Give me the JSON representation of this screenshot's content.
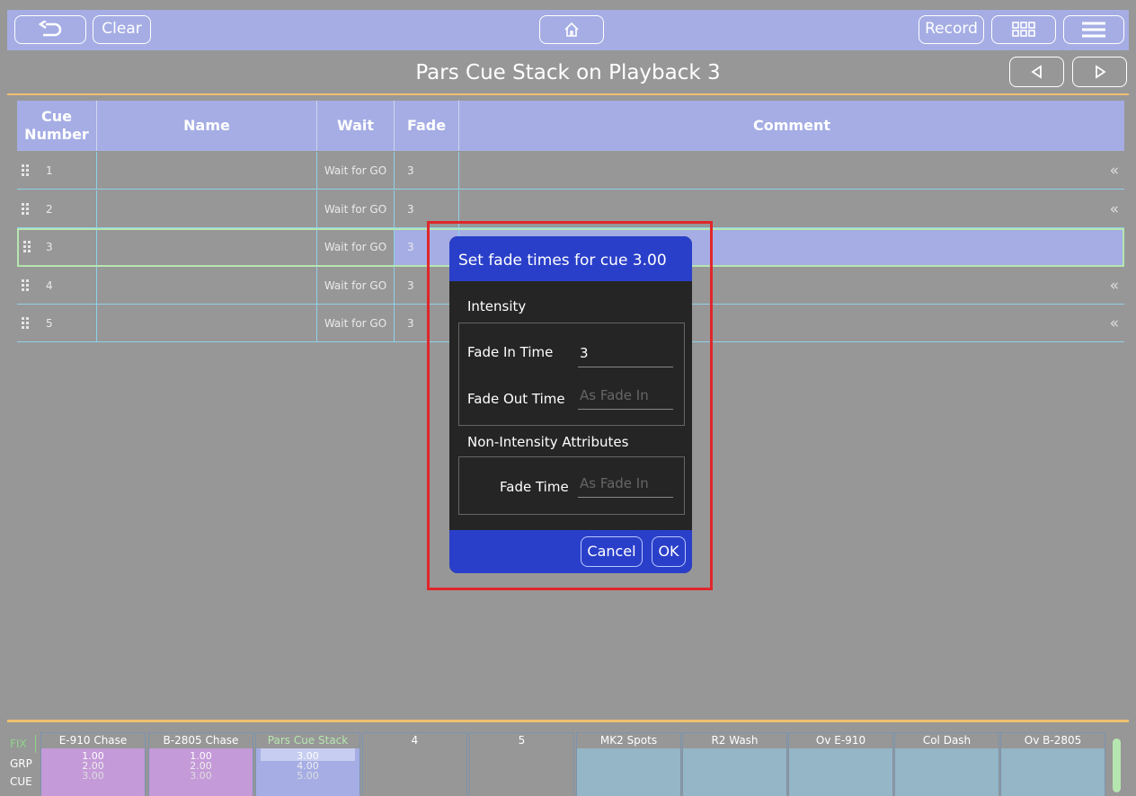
{
  "topbar": {
    "clear_label": "Clear",
    "record_label": "Record",
    "back_icon": "undo-arrow-icon",
    "home_icon": "home-icon",
    "grid_icon": "grid-icon",
    "menu_icon": "hamburger-menu-icon"
  },
  "page": {
    "title": "Pars Cue Stack on Playback 3",
    "prev_icon": "triangle-left-icon",
    "next_icon": "triangle-right-icon"
  },
  "table": {
    "headers": {
      "cue_number": "Cue Number",
      "name": "Name",
      "wait": "Wait",
      "fade": "Fade",
      "comment": "Comment"
    },
    "rows": [
      {
        "number": "1",
        "name": "",
        "wait": "Wait for GO",
        "fade": "3",
        "comment": ""
      },
      {
        "number": "2",
        "name": "",
        "wait": "Wait for GO",
        "fade": "3",
        "comment": ""
      },
      {
        "number": "3",
        "name": "",
        "wait": "Wait for GO",
        "fade": "3",
        "comment": ""
      },
      {
        "number": "4",
        "name": "",
        "wait": "Wait for GO",
        "fade": "3",
        "comment": ""
      },
      {
        "number": "5",
        "name": "",
        "wait": "Wait for GO",
        "fade": "3",
        "comment": ""
      }
    ],
    "selected_row": 3
  },
  "dialog": {
    "title": "Set fade times for cue 3.00",
    "intensity_label": "Intensity",
    "fade_in_label": "Fade In Time",
    "fade_in_value": "3",
    "fade_out_label": "Fade Out Time",
    "fade_out_placeholder": "As Fade In",
    "non_intensity_label": "Non-Intensity Attributes",
    "fade_time_label": "Fade Time",
    "fade_time_placeholder": "As Fade In",
    "cancel_label": "Cancel",
    "ok_label": "OK"
  },
  "playback_bar": {
    "side_labels": [
      "FIX",
      "GRP",
      "CUE"
    ],
    "playbacks": [
      {
        "name": "E-910 Chase",
        "values": [
          "1.00",
          "2.00",
          "3.00"
        ],
        "color": "#c49ad8"
      },
      {
        "name": "B-2805 Chase",
        "values": [
          "1.00",
          "2.00",
          "3.00"
        ],
        "color": "#c49ad8"
      },
      {
        "name": "Pars Cue Stack",
        "values": [
          "3.00",
          "4.00",
          "5.00"
        ],
        "color": "#a5ade4"
      },
      {
        "name": "4",
        "values": [],
        "color": "#979797"
      },
      {
        "name": "5",
        "values": [],
        "color": "#979797"
      },
      {
        "name": "MK2 Spots",
        "values": [],
        "color": "#94b6c6"
      },
      {
        "name": "R2 Wash",
        "values": [],
        "color": "#94b6c6"
      },
      {
        "name": "Ov E-910",
        "values": [],
        "color": "#94b6c6"
      },
      {
        "name": "Col Dash",
        "values": [],
        "color": "#94b6c6"
      },
      {
        "name": "Ov B-2805",
        "values": [],
        "color": "#94b6c6"
      }
    ]
  },
  "colors": {
    "header_blue": "#a5ade4",
    "dialog_blue": "#2a3fc9",
    "accent_orange": "#f0c070",
    "highlight_red": "#e0262a",
    "selected_green": "#b6e6b0"
  }
}
